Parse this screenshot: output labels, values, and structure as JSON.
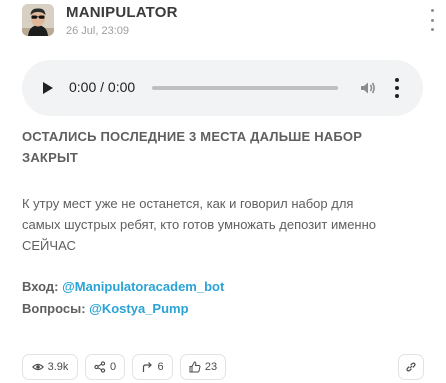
{
  "channel": {
    "name": "MANIPULATOR",
    "date": "26 Jul, 23:09"
  },
  "audio": {
    "time": "0:00 / 0:00",
    "progress": 0
  },
  "post": {
    "headline_line1": "ОСТАЛИСЬ ПОСЛЕДНИЕ 3 МЕСТА ДАЛЬШЕ НАБОР",
    "headline_line2": "ЗАКРЫТ",
    "body_line1": "К утру мест уже не останется, как и говорил набор для",
    "body_line2": "самых шустрых ребят, кто готов умножать депозит именно",
    "body_line3": "СЕЙЧАС",
    "entry_label": "Вход: ",
    "entry_handle": "@Manipulatoracadem_bot",
    "questions_label": "Вопросы: ",
    "questions_handle": "@Kostya_Pump"
  },
  "stats": {
    "views": "3.9k",
    "shares": "0",
    "forwards": "6",
    "likes": "23"
  },
  "icons": {
    "views": "eye-icon",
    "shares": "share-icon",
    "forwards": "forward-arrow-icon",
    "likes": "thumbs-up-icon",
    "link": "link-icon"
  },
  "colors": {
    "link": "#2aa3d6",
    "text": "#5f5f5f",
    "player_bg": "#f1f3f4"
  }
}
